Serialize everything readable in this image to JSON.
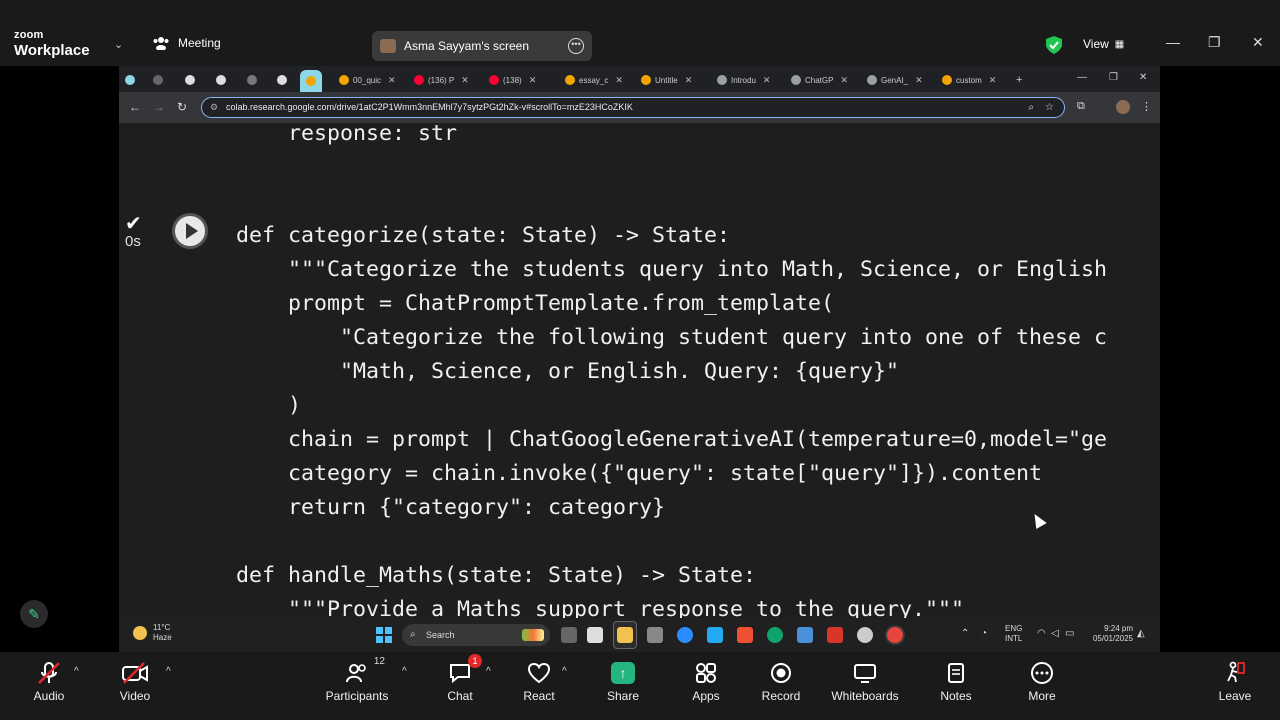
{
  "zoom": {
    "logo_top": "zoom",
    "logo_bottom": "Workplace",
    "meeting_label": "Meeting",
    "share_title": "Asma Sayyam's screen",
    "view_label": "View",
    "toolbar": {
      "audio": "Audio",
      "video": "Video",
      "participants": "Participants",
      "participants_count": "12",
      "chat": "Chat",
      "chat_badge": "1",
      "react": "React",
      "share": "Share",
      "apps": "Apps",
      "record": "Record",
      "whiteboards": "Whiteboards",
      "notes": "Notes",
      "more": "More",
      "leave": "Leave"
    }
  },
  "browser": {
    "tabs": [
      {
        "label": "00_quic",
        "color": "#f4a300"
      },
      {
        "label": "(136) P",
        "color": "#ff0033"
      },
      {
        "label": "(138)",
        "color": "#ff0033"
      },
      {
        "label": "essay_c",
        "color": "#f4a300"
      },
      {
        "label": "Untitle",
        "color": "#f4a300"
      },
      {
        "label": "Introdu",
        "color": "#9aa0a6"
      },
      {
        "label": "ChatGP",
        "color": "#9aa0a6"
      },
      {
        "label": "GenAI_",
        "color": "#9aa0a6"
      },
      {
        "label": "custom",
        "color": "#f4a300"
      }
    ],
    "url": "colab.research.google.com/drive/1atC2P1Wmm3nnEMhl7y7sytzPGt2hZk-v#scrollTo=mzE23HCoZKIK"
  },
  "notebook": {
    "exec_time": "0s",
    "code_lines": [
      "    response: str",
      "",
      "",
      "def categorize(state: State) -> State:",
      "    \"\"\"Categorize the students query into Math, Science, or English",
      "    prompt = ChatPromptTemplate.from_template(",
      "        \"Categorize the following student query into one of these c",
      "        \"Math, Science, or English. Query: {query}\"",
      "    )",
      "    chain = prompt | ChatGoogleGenerativeAI(temperature=0,model=\"ge",
      "    category = chain.invoke({\"query\": state[\"query\"]}).content",
      "    return {\"category\": category}",
      "",
      "def handle_Maths(state: State) -> State:",
      "    \"\"\"Provide a Maths support response to the query.\"\"\""
    ]
  },
  "taskbar": {
    "temp": "11°C",
    "weather": "Haze",
    "search": "Search",
    "lang1": "ENG",
    "lang2": "INTL",
    "time": "9:24 pm",
    "date": "05/01/2025"
  }
}
